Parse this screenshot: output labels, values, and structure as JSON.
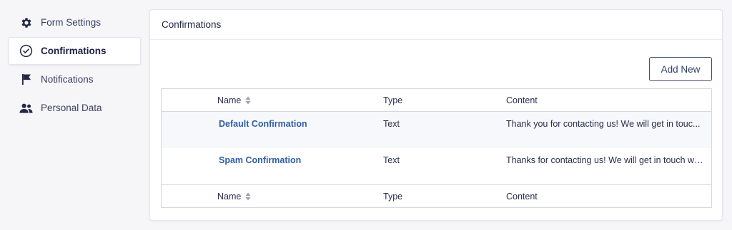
{
  "sidebar": {
    "items": [
      {
        "label": "Form Settings",
        "icon": "gear-icon"
      },
      {
        "label": "Confirmations",
        "icon": "check-circle-icon"
      },
      {
        "label": "Notifications",
        "icon": "flag-icon"
      },
      {
        "label": "Personal Data",
        "icon": "users-icon"
      }
    ],
    "active_index": 1
  },
  "panel": {
    "title": "Confirmations",
    "add_button": "Add New"
  },
  "table": {
    "columns": {
      "name": "Name",
      "type": "Type",
      "content": "Content"
    },
    "rows": [
      {
        "name": "Default Confirmation",
        "type": "Text",
        "content": "Thank you for contacting us! We will get in touc..."
      },
      {
        "name": "Spam Confirmation",
        "type": "Text",
        "content": "Thanks for contacting us! We will get in touch wi..."
      }
    ]
  },
  "colors": {
    "accent": "#3e6db5",
    "text": "#242748",
    "background": "#f6f6f8"
  }
}
